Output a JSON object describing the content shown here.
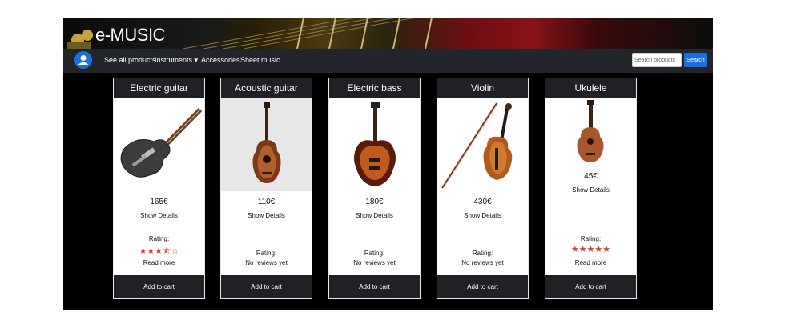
{
  "brand": {
    "name": "e-MUSIC"
  },
  "nav": {
    "items": [
      {
        "label": "See all products"
      },
      {
        "label": "Instruments ▾"
      },
      {
        "label": "Accessories"
      },
      {
        "label": "Sheet music"
      }
    ],
    "search_placeholder": "Search products",
    "search_button": "Search"
  },
  "products": [
    {
      "name": "Electric guitar",
      "price": "165€",
      "details": "Show Details",
      "rating_label": "Rating:",
      "stars": "★★★⯪☆",
      "rating_value": 3.5,
      "review_link": "Read more",
      "cart": "Add to cart",
      "image_icon": "electric-guitar"
    },
    {
      "name": "Acoustic guitar",
      "price": "110€",
      "details": "Show Details",
      "rating_label": "Rating:",
      "review_link": "No reviews yet",
      "cart": "Add to cart",
      "image_icon": "acoustic-guitar"
    },
    {
      "name": "Electric bass",
      "price": "180€",
      "details": "Show Details",
      "rating_label": "Rating:",
      "review_link": "No reviews yet",
      "cart": "Add to cart",
      "image_icon": "bass-guitar"
    },
    {
      "name": "Violin",
      "price": "430€",
      "details": "Show Details",
      "rating_label": "Rating:",
      "review_link": "No reviews yet",
      "cart": "Add to cart",
      "image_icon": "violin"
    },
    {
      "name": "Ukulele",
      "price": "45€",
      "details": "Show Details",
      "rating_label": "Rating:",
      "stars": "★★★★★",
      "rating_value": 5,
      "review_link": "Read more",
      "cart": "Add to cart",
      "image_icon": "ukulele"
    }
  ],
  "colors": {
    "accent": "#1d6fe0",
    "stars": "#e0372b",
    "navbar": "#22252a",
    "card_header": "#1f2125"
  }
}
